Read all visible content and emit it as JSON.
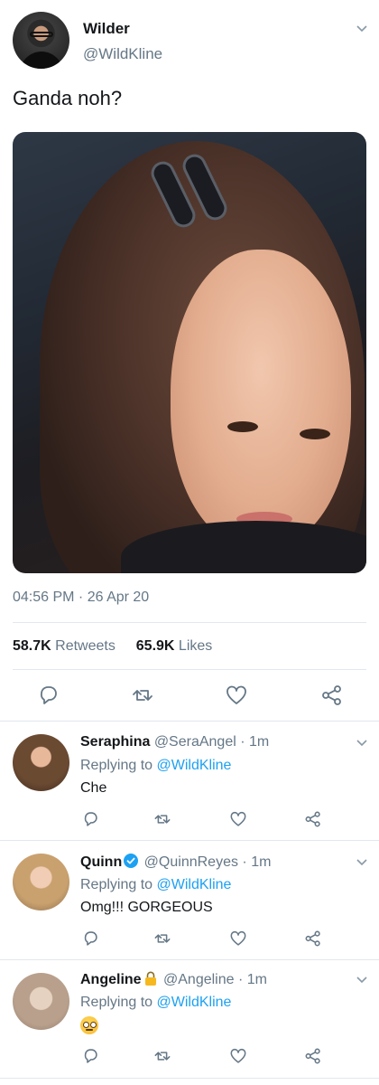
{
  "tweet": {
    "display_name": "Wilder",
    "handle": "@WildKline",
    "text": "Ganda noh?",
    "timestamp": "04:56 PM · 26 Apr 20",
    "retweets_count": "58.7K",
    "retweets_label": "Retweets",
    "likes_count": "65.9K",
    "likes_label": "Likes"
  },
  "replies": [
    {
      "name": "Seraphina",
      "handle": "@SeraAngel",
      "time": "· 1m",
      "replying_prefix": "Replying to",
      "replying_to": "@WildKline",
      "text": "Che",
      "badge": "none"
    },
    {
      "name": "Quinn",
      "handle": "@QuinnReyes",
      "time": "· 1m",
      "replying_prefix": "Replying to",
      "replying_to": "@WildKline",
      "text": "Omg!!! GORGEOUS",
      "badge": "verified-icon"
    },
    {
      "name": "Angeline",
      "handle": "@Angeline",
      "time": "· 1m",
      "replying_prefix": "Replying to",
      "replying_to": "@WildKline",
      "text": "",
      "badge": "lock-icon",
      "emoji": "face-with-rolling-eyes"
    }
  ],
  "icons": {
    "reply": "reply-icon",
    "retweet": "retweet-icon",
    "like": "heart-icon",
    "share": "share-icon",
    "more": "chevron-down-icon"
  },
  "colors": {
    "text": "#14171a",
    "secondary": "#657786",
    "link": "#1da1f2",
    "divider": "#e1e8ed"
  }
}
